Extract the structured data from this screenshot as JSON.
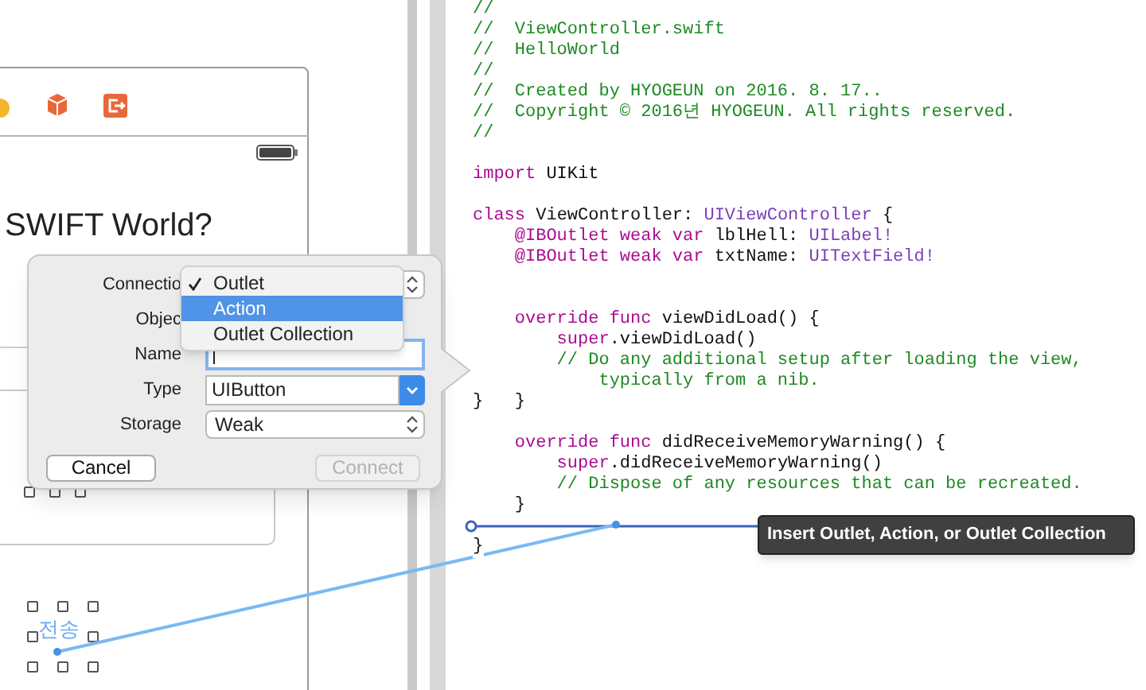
{
  "storyboard": {
    "scene_label": "SWIFT World?",
    "button_label": "전송"
  },
  "popover": {
    "fields": [
      {
        "label": "Connectio",
        "kind": "popup"
      },
      {
        "label": "Objec",
        "kind": "covered"
      },
      {
        "label": "Name",
        "kind": "text",
        "focused": true
      },
      {
        "label": "Type",
        "kind": "combo",
        "value": "UIButton"
      },
      {
        "label": "Storage",
        "kind": "popup",
        "value": "Weak"
      }
    ],
    "menu": [
      {
        "label": "Outlet",
        "checked": true,
        "highlighted": false
      },
      {
        "label": "Action",
        "checked": false,
        "highlighted": true
      },
      {
        "label": "Outlet Collection",
        "checked": false,
        "highlighted": false
      }
    ],
    "buttons": [
      {
        "label": "Cancel",
        "disabled": false
      },
      {
        "label": "Connect",
        "disabled": true
      }
    ]
  },
  "editor": {
    "lines": [
      {
        "kind": "code",
        "tokens": [
          {
            "kind": "comment",
            "text": "//"
          }
        ]
      },
      {
        "kind": "code",
        "tokens": [
          {
            "kind": "comment",
            "text": "//  ViewController.swift"
          }
        ]
      },
      {
        "kind": "code",
        "tokens": [
          {
            "kind": "comment",
            "text": "//  HelloWorld"
          }
        ]
      },
      {
        "kind": "code",
        "tokens": [
          {
            "kind": "comment",
            "text": "//"
          }
        ]
      },
      {
        "kind": "code",
        "tokens": [
          {
            "kind": "comment",
            "text": "//  Created by HYOGEUN on 2016. 8. 17.."
          }
        ]
      },
      {
        "kind": "code",
        "tokens": [
          {
            "kind": "comment",
            "text": "//  Copyright © 2016년 HYOGEUN. All rights reserved."
          }
        ]
      },
      {
        "kind": "code",
        "tokens": [
          {
            "kind": "comment",
            "text": "//"
          }
        ]
      },
      {
        "kind": "blank"
      },
      {
        "kind": "code",
        "tokens": [
          {
            "kind": "keyword",
            "text": "import"
          },
          {
            "kind": "plain",
            "text": " UIKit"
          }
        ]
      },
      {
        "kind": "blank"
      },
      {
        "kind": "code",
        "tokens": [
          {
            "kind": "keyword",
            "text": "class"
          },
          {
            "kind": "plain",
            "text": " ViewController: "
          },
          {
            "kind": "type",
            "text": "UIViewController"
          },
          {
            "kind": "plain",
            "text": " {"
          }
        ]
      },
      {
        "kind": "code",
        "tokens": [
          {
            "kind": "keyword",
            "text": "    @IBOutlet weak var"
          },
          {
            "kind": "plain",
            "text": " lblHell: "
          },
          {
            "kind": "type",
            "text": "UILabel!"
          }
        ]
      },
      {
        "kind": "code",
        "tokens": [
          {
            "kind": "keyword",
            "text": "    @IBOutlet weak var"
          },
          {
            "kind": "plain",
            "text": " txtName: "
          },
          {
            "kind": "type",
            "text": "UITextField!"
          }
        ]
      },
      {
        "kind": "blank"
      },
      {
        "kind": "blank"
      },
      {
        "kind": "code",
        "tokens": [
          {
            "kind": "keyword",
            "text": "    override func"
          },
          {
            "kind": "plain",
            "text": " viewDidLoad() {"
          }
        ]
      },
      {
        "kind": "code",
        "tokens": [
          {
            "kind": "keyword",
            "text": "        super"
          },
          {
            "kind": "plain",
            "text": ".viewDidLoad()"
          }
        ]
      },
      {
        "kind": "code",
        "tokens": [
          {
            "kind": "comment",
            "text": "        // Do any additional setup after loading the view,"
          }
        ]
      },
      {
        "kind": "code",
        "tokens": [
          {
            "kind": "comment",
            "text": "            typically from a nib."
          }
        ]
      },
      {
        "kind": "code",
        "tokens": [
          {
            "kind": "plain",
            "text": "}   }"
          }
        ]
      },
      {
        "kind": "blank"
      },
      {
        "kind": "code",
        "tokens": [
          {
            "kind": "keyword",
            "text": "    override func"
          },
          {
            "kind": "plain",
            "text": " didReceiveMemoryWarning() {"
          }
        ]
      },
      {
        "kind": "code",
        "tokens": [
          {
            "kind": "keyword",
            "text": "        super"
          },
          {
            "kind": "plain",
            "text": ".didReceiveMemoryWarning()"
          }
        ]
      },
      {
        "kind": "code",
        "tokens": [
          {
            "kind": "comment",
            "text": "        // Dispose of any resources that can be recreated."
          }
        ]
      },
      {
        "kind": "code",
        "tokens": [
          {
            "kind": "plain",
            "text": "    }"
          }
        ]
      },
      {
        "kind": "blank"
      },
      {
        "kind": "code",
        "tokens": [
          {
            "kind": "plain",
            "text": "}"
          }
        ]
      }
    ]
  },
  "tooltip": "Insert Outlet, Action, or Outlet Collection"
}
